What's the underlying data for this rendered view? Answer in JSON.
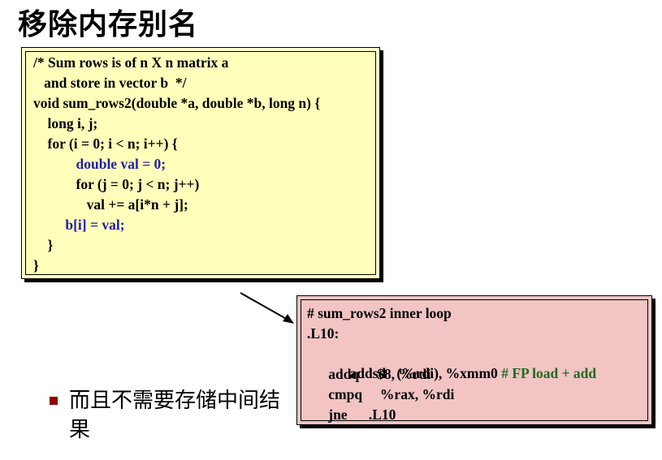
{
  "title": "移除内存别名",
  "code": {
    "lines": [
      "/* Sum rows is of n X n matrix a",
      "   and store in vector b  */",
      "void sum_rows2(double *a, double *b, long n) {",
      "    long i, j;",
      "    for (i = 0; i < n; i++) {",
      "            double val = 0;",
      "            for (j = 0; j < n; j++)",
      "               val += a[i*n + j];",
      "         b[i] = val;",
      "    }",
      "}"
    ]
  },
  "asm": {
    "header": "# sum_rows2 inner loop",
    "label": ".L10:",
    "line1_instr": "      addsd   (%rdi), %xmm0 ",
    "line1_comment": "# FP load + add",
    "line2": "      addq     $8, %rdi",
    "line3": "      cmpq     %rax, %rdi",
    "line4": "      jne      .L10"
  },
  "bullet": {
    "text": "而且不需要存储中间结果"
  },
  "colors": {
    "code_bg": "#ffffbb",
    "asm_bg": "#f2c4c4",
    "highlight_blue": "#1f1fa8",
    "comment_green": "#1f6b1f",
    "bullet": "#8b0000"
  }
}
